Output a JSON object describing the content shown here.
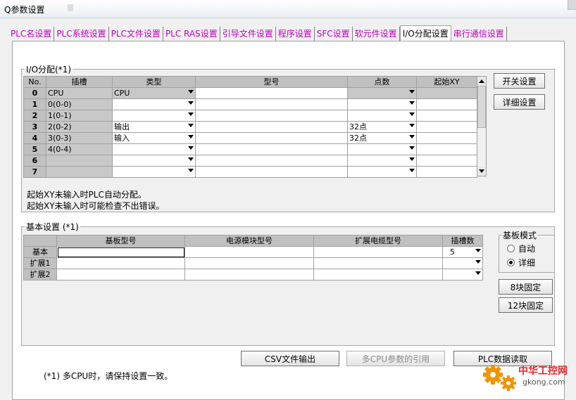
{
  "window": {
    "title": "Q参数设置"
  },
  "tabs": [
    {
      "label": "PLC名设置",
      "active": false
    },
    {
      "label": "PLC系统设置",
      "active": false
    },
    {
      "label": "PLC文件设置",
      "active": false
    },
    {
      "label": "PLC RAS设置",
      "active": false
    },
    {
      "label": "引导文件设置",
      "active": false
    },
    {
      "label": "程序设置",
      "active": false
    },
    {
      "label": "SFC设置",
      "active": false
    },
    {
      "label": "软元件设置",
      "active": false
    },
    {
      "label": "I/O分配设置",
      "active": true
    },
    {
      "label": "串行通信设置",
      "active": false
    }
  ],
  "io_assignment": {
    "legend": "I/O分配(*1)",
    "headers": {
      "no": "No.",
      "slot": "插槽",
      "type": "类型",
      "model": "型号",
      "points": "点数",
      "start_xy": "起始XY"
    },
    "rows": [
      {
        "no": "0",
        "slot": "CPU",
        "type": "CPU",
        "model": "",
        "points": "",
        "start_xy": ""
      },
      {
        "no": "1",
        "slot": "0(0-0)",
        "type": "",
        "model": "",
        "points": "",
        "start_xy": ""
      },
      {
        "no": "2",
        "slot": "1(0-1)",
        "type": "",
        "model": "",
        "points": "",
        "start_xy": ""
      },
      {
        "no": "3",
        "slot": "2(0-2)",
        "type": "输出",
        "model": "",
        "points": "32点",
        "start_xy": ""
      },
      {
        "no": "4",
        "slot": "3(0-3)",
        "type": "输入",
        "model": "",
        "points": "32点",
        "start_xy": ""
      },
      {
        "no": "5",
        "slot": "4(0-4)",
        "type": "",
        "model": "",
        "points": "",
        "start_xy": ""
      },
      {
        "no": "6",
        "slot": "",
        "type": "",
        "model": "",
        "points": "",
        "start_xy": ""
      },
      {
        "no": "7",
        "slot": "",
        "type": "",
        "model": "",
        "points": "",
        "start_xy": ""
      }
    ],
    "note_line1": "起始XY未输入时PLC自动分配。",
    "note_line2": "起始XY未输入时可能检查不出错误。",
    "switch_settings_label": "开关设置",
    "detail_settings_label": "详细设置"
  },
  "base_settings": {
    "legend": "基本设置 (*1)",
    "headers": {
      "base_model": "基板型号",
      "power_model": "电源模块型号",
      "cable_model": "扩展电缆型号",
      "slots": "插槽数"
    },
    "rows": [
      {
        "label": "基本",
        "base_model": "",
        "power_model": "",
        "cable_model": "",
        "slots": "5"
      },
      {
        "label": "扩展1",
        "base_model": "",
        "power_model": "",
        "cable_model": "",
        "slots": ""
      },
      {
        "label": "扩展2",
        "base_model": "",
        "power_model": "",
        "cable_model": "",
        "slots": ""
      }
    ],
    "mode": {
      "legend": "基板模式",
      "auto_label": "自动",
      "detail_label": "详细",
      "selected": "详细"
    },
    "fixed8_label": "8块固定",
    "fixed12_label": "12块固定"
  },
  "bottom": {
    "csv_label": "CSV文件输出",
    "multi_cpu_label": "多CPU参数的引用",
    "plc_read_label": "PLC数据读取",
    "footnote": "(*1) 多CPU时，请保持设置一致。"
  },
  "watermark": {
    "cn": "中华工控网",
    "url": "gkong.com"
  },
  "colors": {
    "tab_text": "#c000c0",
    "header_gray": "#c0c0c0",
    "watermark_red": "#e8222a",
    "watermark_orange": "#f29400"
  }
}
